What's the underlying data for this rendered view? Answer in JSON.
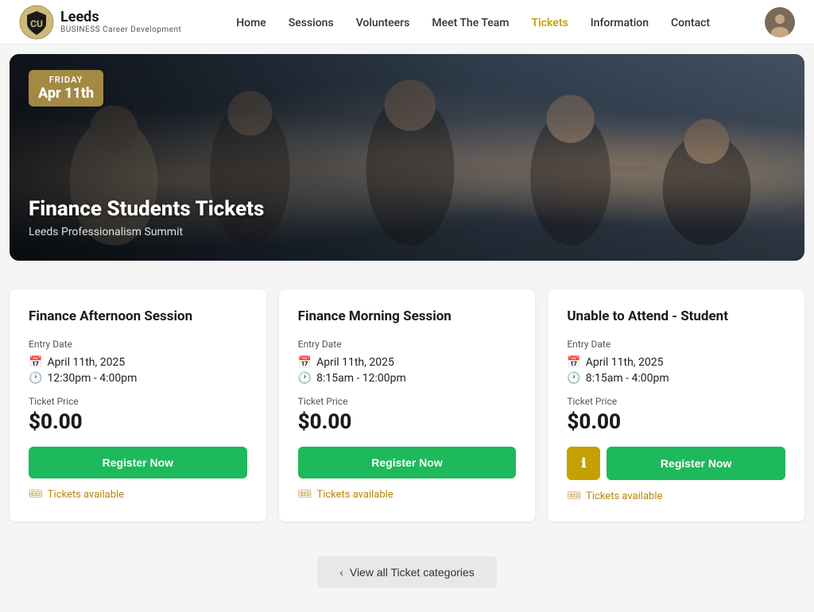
{
  "nav": {
    "logo": {
      "university": "Leeds",
      "line1": "BUSINESS",
      "line2": "Career Development"
    },
    "links": [
      {
        "label": "Home",
        "active": false
      },
      {
        "label": "Sessions",
        "active": false
      },
      {
        "label": "Volunteers",
        "active": false
      },
      {
        "label": "Meet The Team",
        "active": false
      },
      {
        "label": "Tickets",
        "active": true
      },
      {
        "label": "Information",
        "active": false
      },
      {
        "label": "Contact",
        "active": false
      }
    ]
  },
  "hero": {
    "day": "Friday",
    "date": "Apr 11th",
    "title": "Finance Students Tickets",
    "subtitle": "Leeds Professionalism Summit"
  },
  "cards": [
    {
      "id": "card-1",
      "title": "Finance Afternoon Session",
      "entry_date_label": "Entry Date",
      "date": "April 11th, 2025",
      "time": "12:30pm - 4:00pm",
      "ticket_price_label": "Ticket Price",
      "price": "$0.00",
      "register_label": "Register Now",
      "tickets_label": "Tickets available",
      "has_info_btn": false
    },
    {
      "id": "card-2",
      "title": "Finance Morning Session",
      "entry_date_label": "Entry Date",
      "date": "April 11th, 2025",
      "time": "8:15am - 12:00pm",
      "ticket_price_label": "Ticket Price",
      "price": "$0.00",
      "register_label": "Register Now",
      "tickets_label": "Tickets available",
      "has_info_btn": false
    },
    {
      "id": "card-3",
      "title": "Unable to Attend - Student",
      "entry_date_label": "Entry Date",
      "date": "April 11th, 2025",
      "time": "8:15am - 4:00pm",
      "ticket_price_label": "Ticket Price",
      "price": "$0.00",
      "register_label": "Register Now",
      "tickets_label": "Tickets available",
      "has_info_btn": true,
      "info_icon": "ℹ"
    }
  ],
  "view_all": {
    "label": "View all Ticket categories",
    "chevron": "‹"
  }
}
